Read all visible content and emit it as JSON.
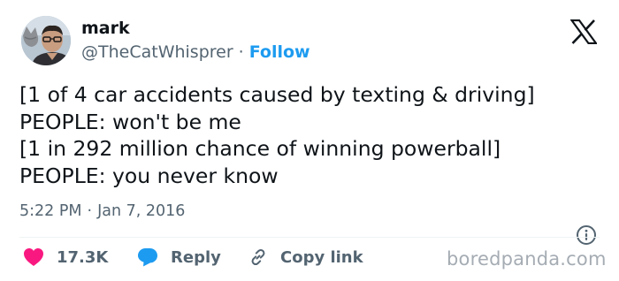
{
  "tweet": {
    "author": {
      "name": "mark",
      "handle": "@TheCatWhisprer",
      "separator": "·",
      "follow_label": "Follow"
    },
    "lines": [
      "[1 of 4 car accidents caused by texting & driving]",
      "PEOPLE: won't be me",
      "[1 in 292 million chance of winning powerball]",
      "PEOPLE: you never know"
    ],
    "time": "5:22 PM",
    "date_separator": "·",
    "date": "Jan 7, 2016"
  },
  "actions": {
    "likes": "17.3K",
    "reply_label": "Reply",
    "copy_label": "Copy link"
  },
  "watermark": "boredpanda.com",
  "colors": {
    "like": "#f91880",
    "reply": "#1d9bf0",
    "follow": "#1d9bf0",
    "secondary_text": "#536471",
    "primary_text": "#0f1419",
    "watermark": "#a5acb3"
  },
  "icons": [
    "x-logo-icon",
    "heart-icon",
    "reply-bubble-icon",
    "link-icon",
    "info-icon"
  ]
}
